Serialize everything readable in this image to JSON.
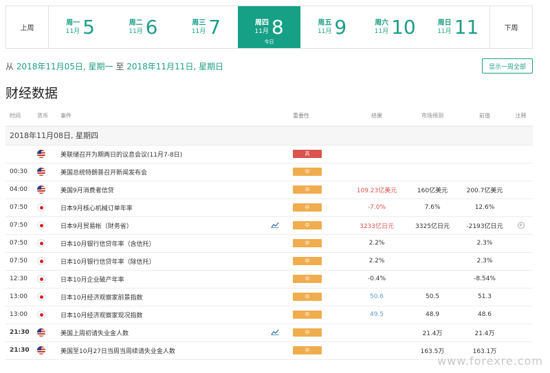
{
  "week_nav": {
    "prev_label": "上周",
    "next_label": "下周",
    "days": [
      {
        "weekday": "周一",
        "month": "11月",
        "day": "5",
        "active": false
      },
      {
        "weekday": "周二",
        "month": "11月",
        "day": "6",
        "active": false
      },
      {
        "weekday": "周三",
        "month": "11月",
        "day": "7",
        "active": false
      },
      {
        "weekday": "周四",
        "month": "11月",
        "day": "8",
        "active": true,
        "today": "今日"
      },
      {
        "weekday": "周五",
        "month": "11月",
        "day": "9",
        "active": false
      },
      {
        "weekday": "周六",
        "month": "11月",
        "day": "10",
        "active": false
      },
      {
        "weekday": "周日",
        "month": "11月",
        "day": "11",
        "active": false
      }
    ]
  },
  "range": {
    "from_word": "从",
    "start": "2018年11月05日, 星期一",
    "to_word": "至",
    "end": "2018年11月11日, 星期日"
  },
  "show_all_label": "显示一周全部",
  "page_title": "财经数据",
  "table": {
    "headers": {
      "time": "时间",
      "currency": "货币",
      "event": "事件",
      "importance": "重要性",
      "result": "结果",
      "forecast": "市场预测",
      "previous": "前值",
      "note": "注释"
    },
    "group_label": "2018年11月08日, 星期四",
    "rows": [
      {
        "time": "",
        "bold": false,
        "flag": "us",
        "event": "美联储召开为期两日的议息会议(11月7-8日)",
        "chart": false,
        "importance": "高",
        "level": "high",
        "result": "",
        "result_color": "",
        "forecast": "",
        "previous": "",
        "note": false
      },
      {
        "time": "00:30",
        "bold": false,
        "flag": "us",
        "event": "美国总统特朗普召开新闻发布会",
        "chart": false,
        "importance": "中",
        "level": "mid",
        "result": "",
        "result_color": "",
        "forecast": "",
        "previous": "",
        "note": false
      },
      {
        "time": "04:00",
        "bold": false,
        "flag": "us",
        "event": "美国9月消费者信贷",
        "chart": false,
        "importance": "中",
        "level": "mid",
        "result": "109.23亿美元",
        "result_color": "red",
        "forecast": "160亿美元",
        "previous": "200.7亿美元",
        "note": false
      },
      {
        "time": "07:50",
        "bold": false,
        "flag": "jp",
        "event": "日本9月核心机械订单年率",
        "chart": false,
        "importance": "中",
        "level": "mid",
        "result": "-7.0%",
        "result_color": "red",
        "forecast": "7.6%",
        "previous": "12.6%",
        "note": false
      },
      {
        "time": "07:50",
        "bold": false,
        "flag": "jp",
        "event": "日本9月贸易帐（财务省）",
        "chart": true,
        "importance": "中",
        "level": "mid",
        "result": "3233亿日元",
        "result_color": "red",
        "forecast": "3325亿日元",
        "previous": "-2193亿日元",
        "note": true
      },
      {
        "time": "07:50",
        "bold": false,
        "flag": "jp",
        "event": "日本10月银行信贷年率（含信托）",
        "chart": false,
        "importance": "中",
        "level": "mid",
        "result": "2.2%",
        "result_color": "",
        "forecast": "",
        "previous": "2.3%",
        "note": false
      },
      {
        "time": "07:50",
        "bold": false,
        "flag": "jp",
        "event": "日本10月银行信贷年率（除信托）",
        "chart": false,
        "importance": "中",
        "level": "mid",
        "result": "2.2%",
        "result_color": "",
        "forecast": "",
        "previous": "2.3%",
        "note": false
      },
      {
        "time": "12:30",
        "bold": false,
        "flag": "jp",
        "event": "日本10月企业破产年率",
        "chart": false,
        "importance": "中",
        "level": "mid",
        "result": "-0.4%",
        "result_color": "",
        "forecast": "",
        "previous": "-8.54%",
        "note": false
      },
      {
        "time": "13:00",
        "bold": false,
        "flag": "jp",
        "event": "日本10月经济观察家前景指数",
        "chart": false,
        "importance": "中",
        "level": "mid",
        "result": "50.6",
        "result_color": "blue",
        "forecast": "50.5",
        "previous": "51.3",
        "note": false
      },
      {
        "time": "13:00",
        "bold": false,
        "flag": "jp",
        "event": "日本10月经济观察家现况指数",
        "chart": false,
        "importance": "中",
        "level": "mid",
        "result": "49.5",
        "result_color": "blue",
        "forecast": "48.9",
        "previous": "48.6",
        "note": false
      },
      {
        "time": "21:30",
        "bold": true,
        "flag": "us",
        "event": "美国上周初请失业金人数",
        "chart": true,
        "importance": "中",
        "level": "mid",
        "result": "",
        "result_color": "",
        "forecast": "21.4万",
        "previous": "21.4万",
        "note": false
      },
      {
        "time": "21:30",
        "bold": true,
        "flag": "us",
        "event": "美国至10月27日当周当周续请失业金人数",
        "chart": false,
        "importance": "中",
        "level": "mid",
        "result": "",
        "result_color": "",
        "forecast": "163.5万",
        "previous": "163.1万",
        "note": false
      }
    ]
  },
  "watermark": "www.forexre.com",
  "colors": {
    "accent": "#16a085",
    "high": "#d9534f",
    "mid": "#f0ad4e",
    "negative": "#d9534f",
    "positive": "#5b9bd5"
  }
}
